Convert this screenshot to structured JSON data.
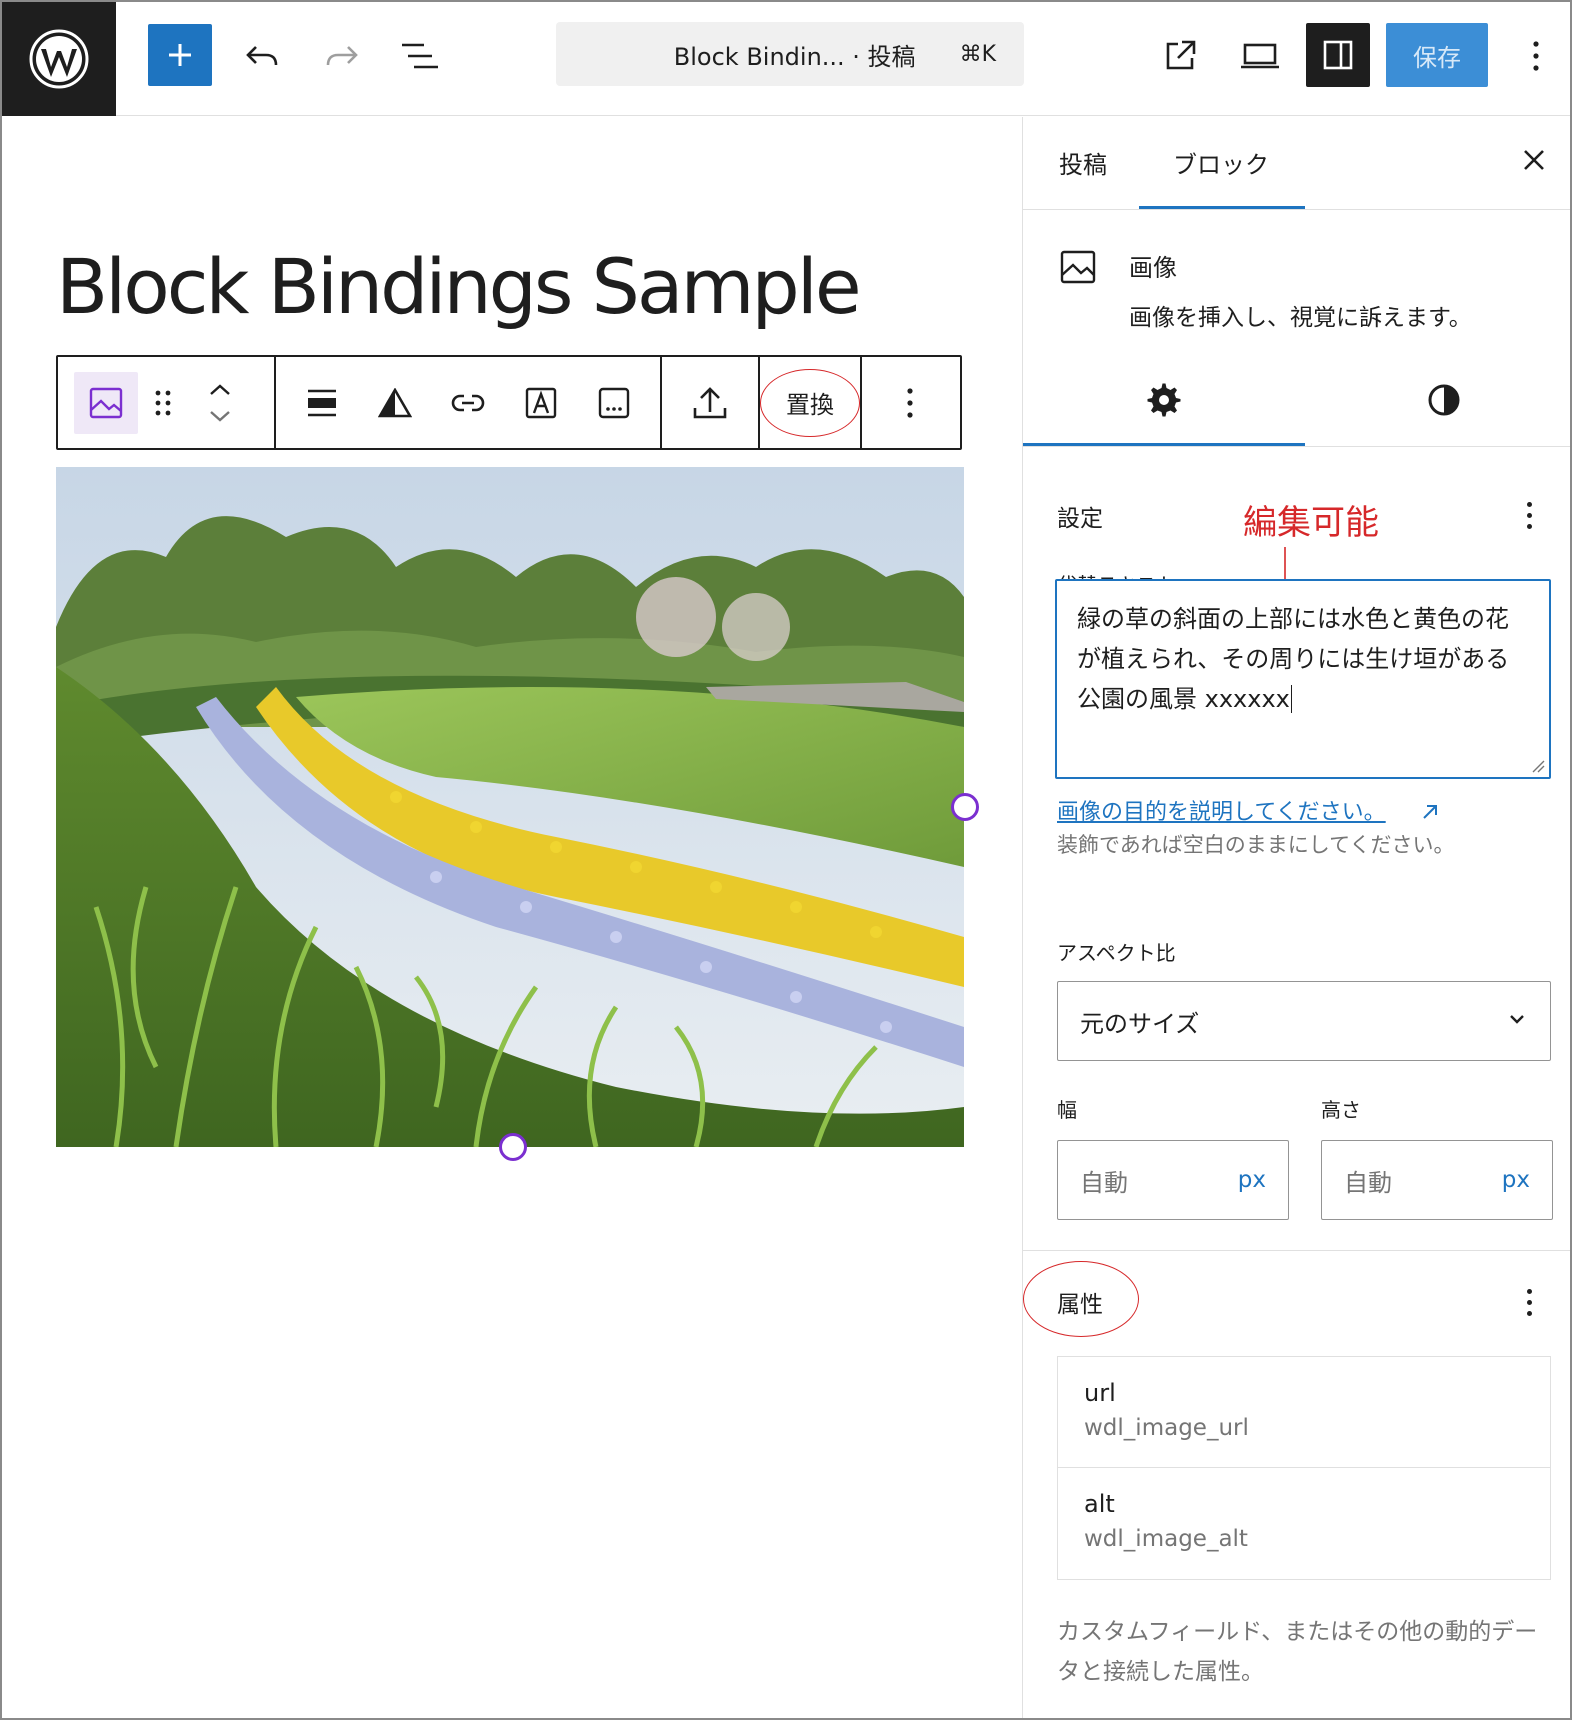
{
  "header": {
    "command_title": "Block Bindin... · 投稿",
    "command_shortcut": "⌘K",
    "save_label": "保存"
  },
  "canvas": {
    "post_title": "Block Bindings Sample",
    "toolbar": {
      "replace_label": "置換"
    }
  },
  "sidebar": {
    "tabs": [
      {
        "label": "投稿",
        "active": false
      },
      {
        "label": "ブロック",
        "active": true
      }
    ],
    "block": {
      "name": "画像",
      "description": "画像を挿入し、視覚に訴えます。"
    },
    "settings": {
      "title": "設定",
      "annotation": "編集可能",
      "alt_label": "代替テキスト",
      "alt_value": "緑の草の斜面の上部には水色と黄色の花が植えられ、その周りには生け垣がある公園の風景 xxxxxx",
      "help_link": "画像の目的を説明してください。",
      "help_text": "装飾であれば空白のままにしてください。",
      "aspect_label": "アスペクト比",
      "aspect_value": "元のサイズ",
      "width_label": "幅",
      "height_label": "高さ",
      "width_placeholder": "自動",
      "height_placeholder": "自動",
      "unit": "px"
    },
    "attributes": {
      "title": "属性",
      "items": [
        {
          "key": "url",
          "value": "wdl_image_url"
        },
        {
          "key": "alt",
          "value": "wdl_image_alt"
        }
      ],
      "help": "カスタムフィールド、またはその他の動的データと接続した属性。"
    }
  },
  "colors": {
    "accent": "#1e74c0",
    "annotation": "#d6282a",
    "handle": "#7b2fd0"
  },
  "icons": [
    "wordpress-logo-icon",
    "plus-icon",
    "undo-icon",
    "redo-icon",
    "list-view-icon",
    "external-link-icon",
    "desktop-preview-icon",
    "sidebar-icon",
    "more-vertical-icon",
    "image-icon",
    "drag-handle-icon",
    "chevron-up-icon",
    "chevron-down-icon",
    "align-icon",
    "duotone-icon",
    "link-icon",
    "text-overlay-icon",
    "caption-icon",
    "upload-icon",
    "close-icon",
    "settings-gear-icon",
    "styles-contrast-icon",
    "resize-grip-icon",
    "arrow-up-right-icon"
  ]
}
